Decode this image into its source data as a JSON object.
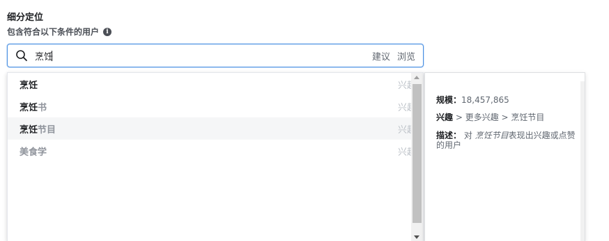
{
  "section": {
    "title": "细分定位",
    "subtitle": "包含符合以下条件的用户",
    "info_icon": "info-icon"
  },
  "search": {
    "value": "烹饪",
    "suggest_label": "建议",
    "browse_label": "浏览",
    "icon": "search-icon"
  },
  "dropdown": {
    "items": [
      {
        "label_bold": "烹饪",
        "label_rest": "",
        "type": "兴趣",
        "highlighted": false
      },
      {
        "label_bold": "烹饪",
        "label_rest": "书",
        "type": "兴趣",
        "highlighted": false
      },
      {
        "label_bold": "烹饪",
        "label_rest": "节目",
        "type": "兴趣",
        "highlighted": true
      },
      {
        "label_bold": "",
        "label_rest": "美食学",
        "type": "兴趣",
        "highlighted": false
      }
    ]
  },
  "detail": {
    "size_key": "规模：",
    "size_value": "18,457,865",
    "interest_key": "兴趣",
    "interest_path": " > 更多兴趣 > 烹饪节目",
    "desc_key": "描述：",
    "desc_pre": " 对 ",
    "desc_em": "烹饪节目",
    "desc_post": "表现出兴趣或点赞的用户"
  }
}
